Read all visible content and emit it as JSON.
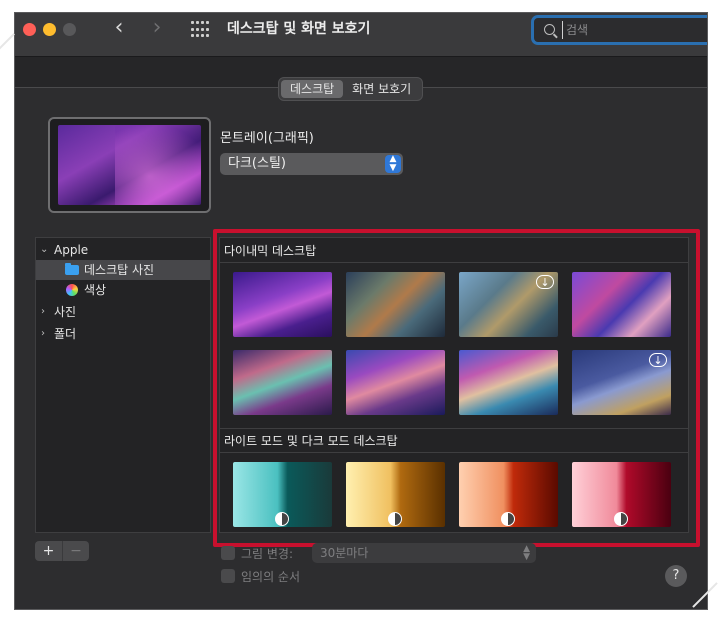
{
  "window": {
    "title": "데스크탑 및 화면 보호기",
    "search_placeholder": "검색"
  },
  "tabs": [
    {
      "label": "데스크탑",
      "active": true
    },
    {
      "label": "화면 보호기",
      "active": false
    }
  ],
  "preview": {
    "wallpaper_name": "몬트레이(그래픽)",
    "variant": "다크(스틸)"
  },
  "sidebar": {
    "groups": [
      {
        "label": "Apple",
        "expanded": true
      },
      {
        "label": "데스크탑 사진",
        "selected": true,
        "icon": "folder-icon"
      },
      {
        "label": "색상",
        "icon": "color-wheel-icon"
      },
      {
        "label": "사진",
        "expanded": false
      },
      {
        "label": "폴더",
        "expanded": false
      }
    ]
  },
  "sections": {
    "dynamic": "다이내믹 데스크탑",
    "light_dark": "라이트 모드 및 다크 모드 데스크탑"
  },
  "bottom": {
    "add_label": "+",
    "remove_label": "−",
    "change_picture": "그림 변경:",
    "interval": "30분마다",
    "random_order": "임의의 순서",
    "help": "?"
  },
  "colors": {
    "accent": "#2f78d8",
    "highlight": "#c8102e",
    "window_bg": "#2d2d2f"
  }
}
